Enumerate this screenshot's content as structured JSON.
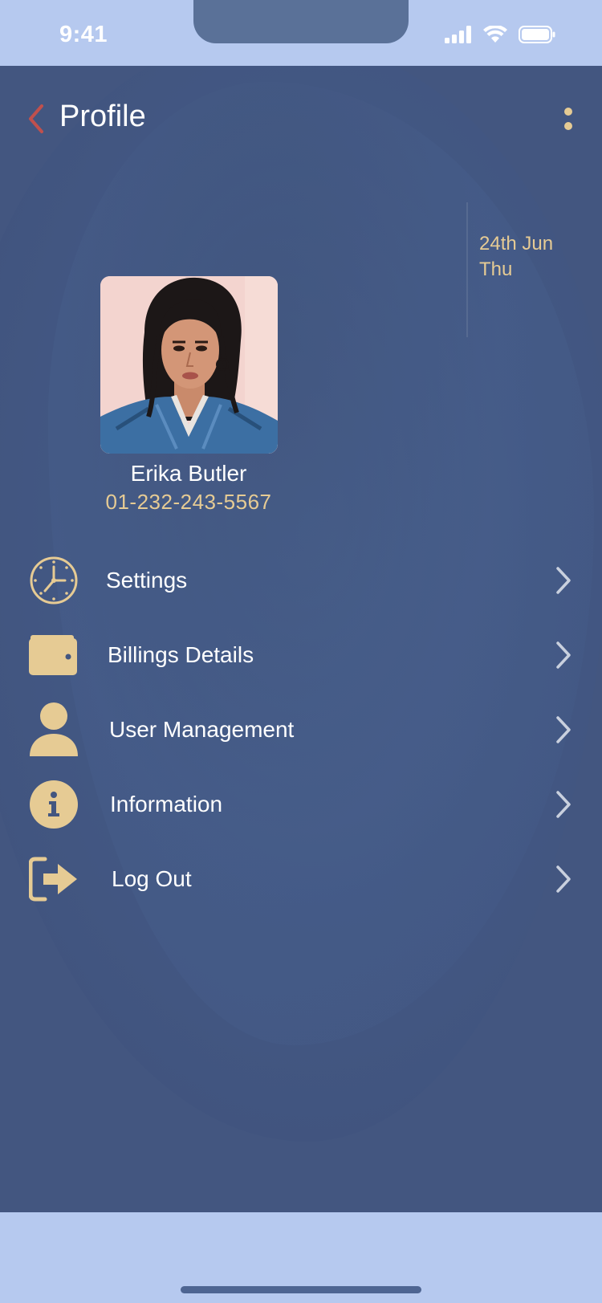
{
  "status_bar": {
    "time": "9:41"
  },
  "header": {
    "title": "Profile"
  },
  "date": {
    "line1": "24th Jun",
    "line2": "Thu"
  },
  "profile": {
    "name": "Erika Butler",
    "phone": "01-232-243-5567"
  },
  "menu": {
    "items": [
      {
        "label": "Settings",
        "icon": "clock-icon"
      },
      {
        "label": "Billings Details",
        "icon": "wallet-icon"
      },
      {
        "label": "User Management",
        "icon": "user-icon"
      },
      {
        "label": "Information",
        "icon": "info-icon"
      },
      {
        "label": "Log Out",
        "icon": "logout-icon"
      }
    ]
  },
  "colors": {
    "accent": "#e6cb94",
    "background": "#435680",
    "back_arrow": "#c0504d",
    "frame": "#b6c9ef"
  }
}
